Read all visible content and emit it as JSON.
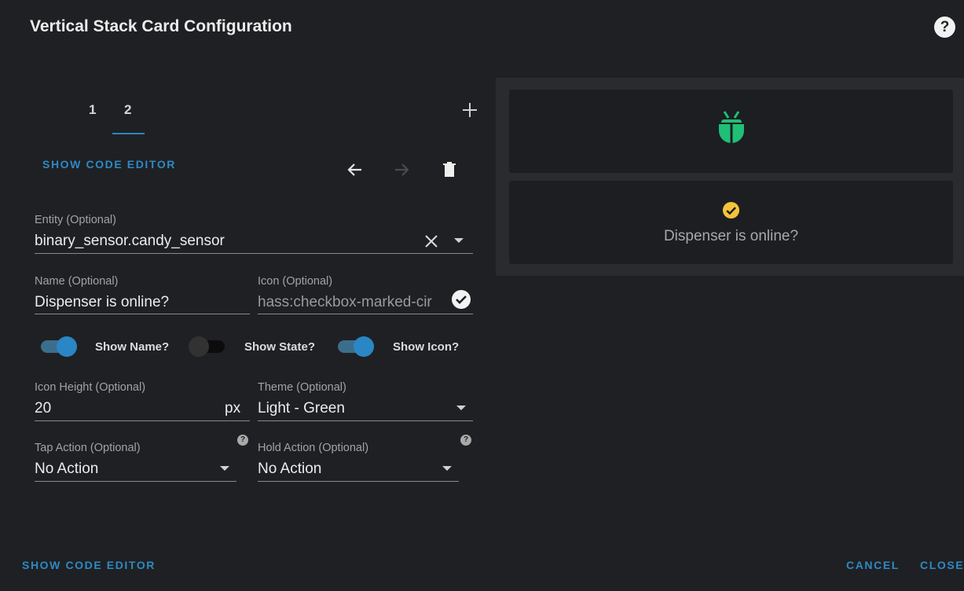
{
  "dialog": {
    "title": "Vertical Stack Card Configuration",
    "help_icon": "help-circle-icon"
  },
  "tabs": [
    {
      "label": "1",
      "active": false
    },
    {
      "label": "2",
      "active": true
    }
  ],
  "add_card_icon": "plus-icon",
  "editor": {
    "show_code_editor": "SHOW CODE EDITOR",
    "toolbar_icons": [
      "arrow-left-icon",
      "arrow-right-icon",
      "delete-icon"
    ],
    "entity": {
      "label": "Entity (Optional)",
      "value": "binary_sensor.candy_sensor"
    },
    "name": {
      "label": "Name (Optional)",
      "value": "Dispenser is online?"
    },
    "icon": {
      "label": "Icon (Optional)",
      "value": "hass:checkbox-marked-cir"
    },
    "switches": [
      {
        "label": "Show Name?",
        "on": true
      },
      {
        "label": "Show State?",
        "on": false
      },
      {
        "label": "Show Icon?",
        "on": true
      }
    ],
    "icon_height": {
      "label": "Icon Height (Optional)",
      "value": "20",
      "suffix": "px"
    },
    "theme": {
      "label": "Theme (Optional)",
      "value": "Light - Green"
    },
    "tap_action": {
      "label": "Tap Action (Optional)",
      "value": "No Action"
    },
    "hold_action": {
      "label": "Hold Action (Optional)",
      "value": "No Action"
    }
  },
  "preview": {
    "card1_icon": "ladybug-icon",
    "card2_icon": "checkbox-marked-circle-icon",
    "card2_name": "Dispenser is online?",
    "colors": {
      "bug": "#1fbf76",
      "check": "#f5c33b"
    }
  },
  "footer": {
    "show_code_editor": "SHOW CODE EDITOR",
    "cancel": "CANCEL",
    "close": "CLOSE"
  },
  "colors": {
    "accent": "#2a86c5",
    "background": "#1f2023"
  }
}
